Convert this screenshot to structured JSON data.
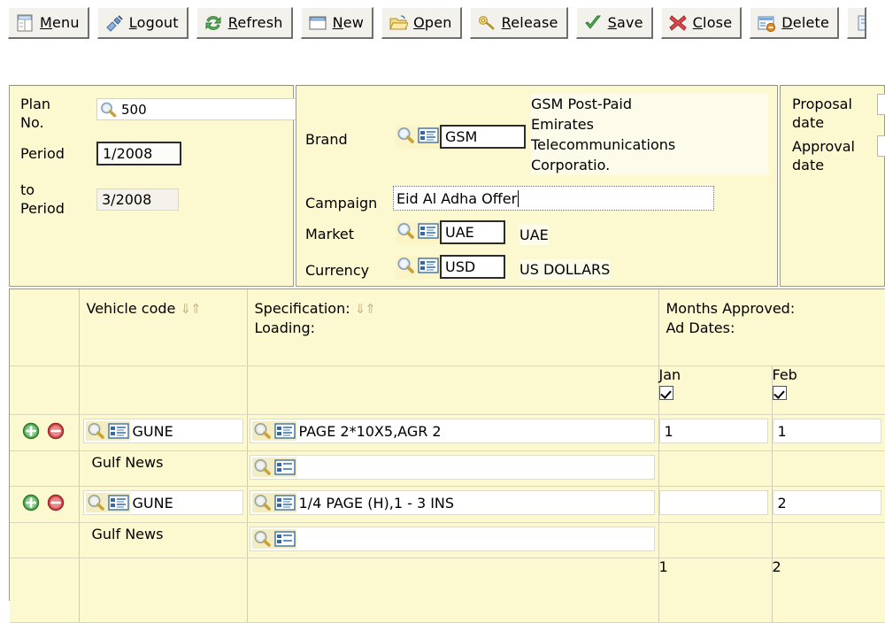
{
  "toolbar": {
    "buttons": [
      {
        "label": "Menu",
        "accel": "M",
        "icon": "menu-window-icon"
      },
      {
        "label": "Logout",
        "accel": "L",
        "icon": "logout-plug-icon"
      },
      {
        "label": "Refresh",
        "accel": "R",
        "icon": "refresh-arrows-icon"
      },
      {
        "label": "New",
        "accel": "N",
        "icon": "new-window-icon"
      },
      {
        "label": "Open",
        "accel": "O",
        "icon": "open-folder-icon"
      },
      {
        "label": "Release",
        "accel": "R",
        "icon": "release-key-icon"
      },
      {
        "label": "Save",
        "accel": "S",
        "icon": "save-check-icon"
      },
      {
        "label": "Close",
        "accel": "C",
        "icon": "close-x-icon"
      },
      {
        "label": "Delete",
        "accel": "D",
        "icon": "delete-record-icon"
      },
      {
        "label": "",
        "accel": "",
        "icon": "clipped-icon"
      }
    ]
  },
  "plan_panel": {
    "plan_no_label": "Plan No.",
    "plan_no_value": "500",
    "period_label": "Period",
    "period_value": "1/2008",
    "to_period_label": "to Period",
    "to_period_value": "3/2008"
  },
  "brand_panel": {
    "brand_label": "Brand",
    "brand_code": "GSM",
    "brand_desc_line1": "GSM Post-Paid",
    "brand_desc_line2": "Emirates",
    "brand_desc_line3": "Telecommunications",
    "brand_desc_line4": "Corporatio.",
    "campaign_label": "Campaign",
    "campaign_value": "Eid Al Adha Offer",
    "market_label": "Market",
    "market_code": "UAE",
    "market_desc": "UAE",
    "currency_label": "Currency",
    "currency_code": "USD",
    "currency_desc": "US DOLLARS"
  },
  "date_panel": {
    "proposal_date_label": "Proposal date",
    "approval_date_label": "Approval date",
    "proposal_date_value": "",
    "approval_date_value": ""
  },
  "grid": {
    "headers": {
      "vehicle_code": "Vehicle code",
      "specification": "Specification:",
      "loading": "Loading:",
      "months_approved": "Months Approved:",
      "ad_dates": "Ad Dates:",
      "sort_arrows": "⇓⇑"
    },
    "months": [
      {
        "name": "Jan",
        "checked": true
      },
      {
        "name": "Feb",
        "checked": true
      }
    ],
    "rows": [
      {
        "vehicle_code": "GUNE",
        "vehicle_name": "Gulf News",
        "specification": "PAGE 2*10X5,AGR 2",
        "loading": "",
        "jan": "1",
        "feb": "1"
      },
      {
        "vehicle_code": "GUNE",
        "vehicle_name": "Gulf News",
        "specification": "1/4 PAGE (H),1 - 3 INS",
        "loading": "",
        "jan": "",
        "feb": "2"
      }
    ],
    "totals": {
      "jan": "1",
      "feb": "2"
    }
  },
  "colors": {
    "panel_bg": "#fcf8d0",
    "panel_border": "#9a9a86",
    "input_bg": "#ffffff",
    "sort_arrow": "#c3b77f",
    "add_icon": "#3c9a3c",
    "remove_icon": "#cc3b3b"
  }
}
